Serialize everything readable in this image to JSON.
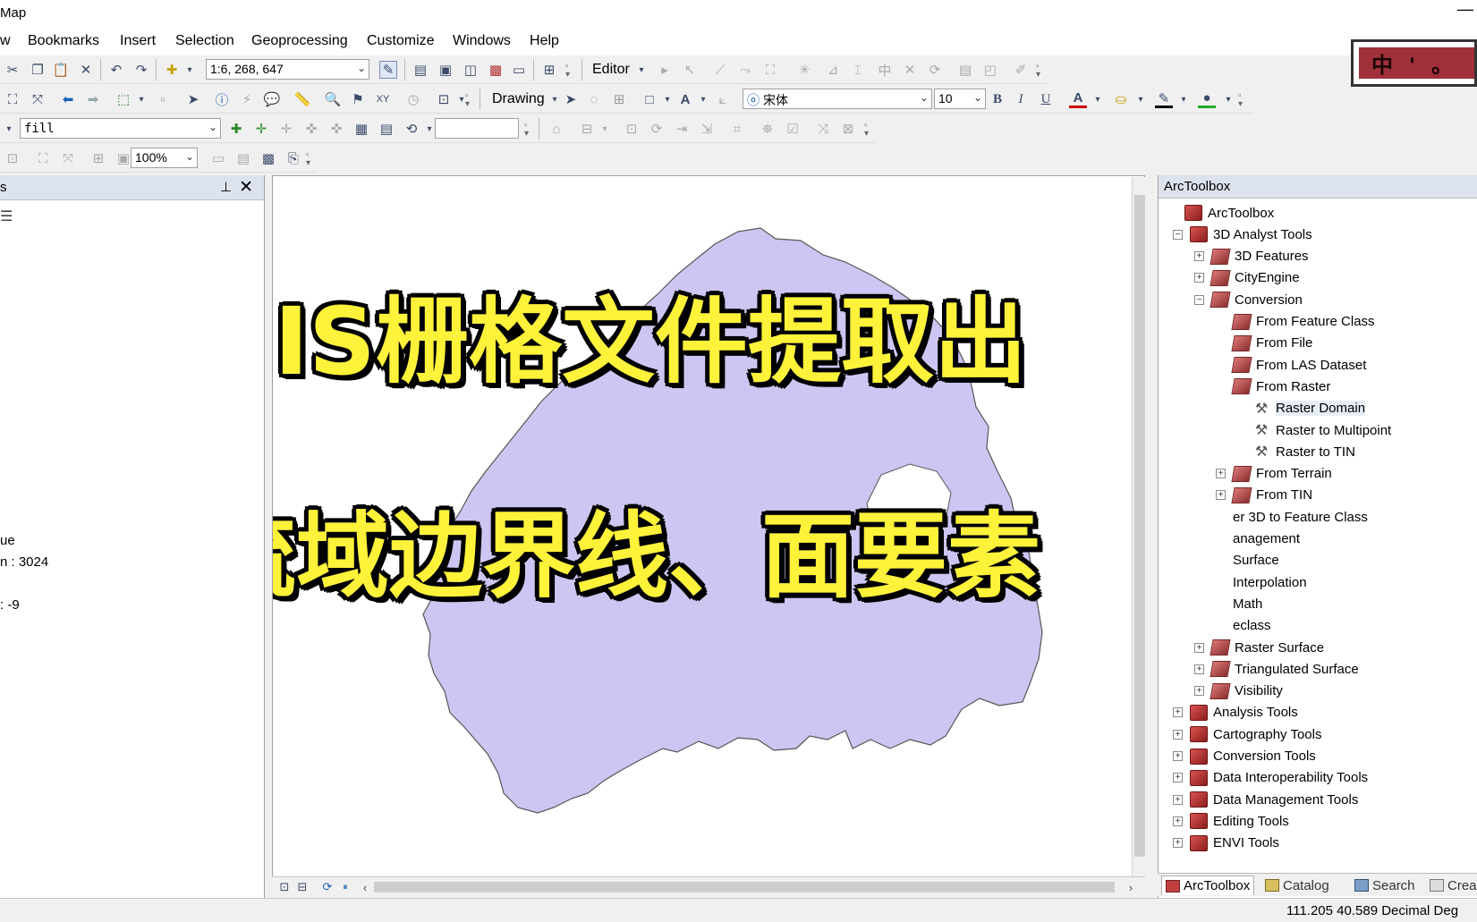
{
  "window": {
    "title": "Map",
    "minimize": "—"
  },
  "menu": [
    "w",
    "Bookmarks",
    "Insert",
    "Selection",
    "Geoprocessing",
    "Customize",
    "Windows",
    "Help"
  ],
  "toolbar": {
    "scale": "1:6, 268, 647",
    "editor_label": "Editor",
    "drawing_label": "Drawing",
    "font_name": "宋体",
    "font_size": "10",
    "bold": "B",
    "italic": "I",
    "underline": "U",
    "font_color": "A",
    "layer_combo": "fill",
    "zoom": "100%",
    "blank_input": ""
  },
  "ime": {
    "text": "中 ' 。"
  },
  "toc": {
    "title": "s",
    "lines": [
      "ue",
      "n : 3024",
      ": -9"
    ]
  },
  "overlay": {
    "line1": "GIS栅格文件提取出",
    "line2": "流域边界线、面要素"
  },
  "toolbox": {
    "title": "ArcToolbox",
    "rows": [
      {
        "label": "ArcToolbox",
        "level": 0,
        "kind": "root",
        "exp": ""
      },
      {
        "label": "3D Analyst Tools",
        "level": 1,
        "kind": "toolbox",
        "exp": "−"
      },
      {
        "label": "3D Features",
        "level": 2,
        "kind": "toolset",
        "exp": "+"
      },
      {
        "label": "CityEngine",
        "level": 2,
        "kind": "toolset",
        "exp": "+"
      },
      {
        "label": "Conversion",
        "level": 2,
        "kind": "toolset",
        "exp": "−"
      },
      {
        "label": "From Feature Class",
        "level": 3,
        "kind": "toolset",
        "exp": ""
      },
      {
        "label": "From File",
        "level": 3,
        "kind": "toolset",
        "exp": ""
      },
      {
        "label": "From LAS Dataset",
        "level": 3,
        "kind": "toolset",
        "exp": ""
      },
      {
        "label": "From Raster",
        "level": 3,
        "kind": "toolset",
        "exp": ""
      },
      {
        "label": "Raster Domain",
        "level": 4,
        "kind": "tool",
        "exp": "",
        "selected": true
      },
      {
        "label": "Raster to Multipoint",
        "level": 4,
        "kind": "tool",
        "exp": ""
      },
      {
        "label": "Raster to TIN",
        "level": 4,
        "kind": "tool",
        "exp": ""
      },
      {
        "label": "From Terrain",
        "level": 3,
        "kind": "toolset",
        "exp": "+"
      },
      {
        "label": "From TIN",
        "level": 3,
        "kind": "toolset",
        "exp": "+"
      },
      {
        "label": "er 3D to Feature Class",
        "level": 3,
        "kind": "none",
        "exp": ""
      },
      {
        "label": "anagement",
        "level": 3,
        "kind": "none",
        "exp": ""
      },
      {
        "label": "Surface",
        "level": 3,
        "kind": "none",
        "exp": ""
      },
      {
        "label": "Interpolation",
        "level": 3,
        "kind": "none",
        "exp": ""
      },
      {
        "label": "Math",
        "level": 3,
        "kind": "none",
        "exp": ""
      },
      {
        "label": "eclass",
        "level": 3,
        "kind": "none",
        "exp": ""
      },
      {
        "label": "Raster Surface",
        "level": 2,
        "kind": "toolset",
        "exp": "+"
      },
      {
        "label": "Triangulated Surface",
        "level": 2,
        "kind": "toolset",
        "exp": "+"
      },
      {
        "label": "Visibility",
        "level": 2,
        "kind": "toolset",
        "exp": "+"
      },
      {
        "label": "Analysis Tools",
        "level": 1,
        "kind": "toolbox",
        "exp": "+"
      },
      {
        "label": "Cartography Tools",
        "level": 1,
        "kind": "toolbox",
        "exp": "+"
      },
      {
        "label": "Conversion Tools",
        "level": 1,
        "kind": "toolbox",
        "exp": "+"
      },
      {
        "label": "Data Interoperability Tools",
        "level": 1,
        "kind": "toolbox",
        "exp": "+"
      },
      {
        "label": "Data Management Tools",
        "level": 1,
        "kind": "toolbox",
        "exp": "+"
      },
      {
        "label": "Editing Tools",
        "level": 1,
        "kind": "toolbox",
        "exp": "+"
      },
      {
        "label": "ENVI Tools",
        "level": 1,
        "kind": "toolbox",
        "exp": "+"
      }
    ],
    "tabs": [
      "ArcToolbox",
      "Catalog",
      "Search",
      "Crea"
    ]
  },
  "status": {
    "coords": "111.205  40.589 Decimal Deg"
  },
  "colors": {
    "basin_fill": "#cdc6f2",
    "basin_stroke": "#555555",
    "overlay_text": "#fff23a",
    "panel_header": "#dde3ee"
  }
}
